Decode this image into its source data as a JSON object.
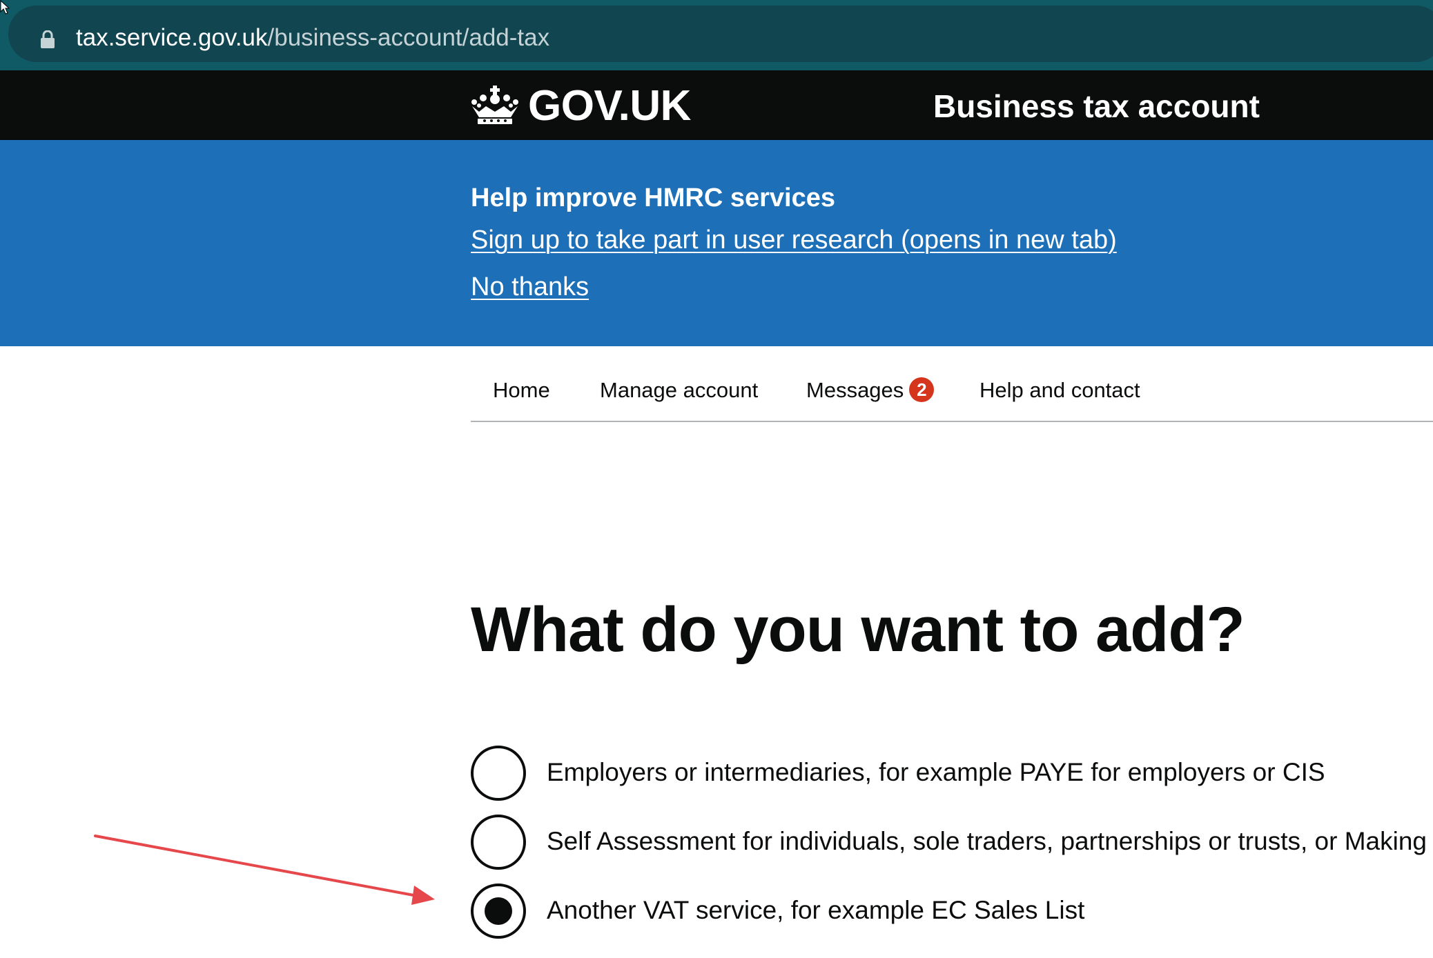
{
  "browser": {
    "url_host": "tax.service.gov.uk",
    "url_path": "/business-account/add-tax"
  },
  "header": {
    "logotype": "GOV.UK",
    "service_name": "Business tax account"
  },
  "banner": {
    "title": "Help improve HMRC services",
    "signup_link": "Sign up to take part in user research (opens in new tab)",
    "dismiss_link": "No thanks"
  },
  "nav": {
    "home": "Home",
    "manage": "Manage account",
    "messages": "Messages",
    "messages_count": "2",
    "help": "Help and contact"
  },
  "main": {
    "heading": "What do you want to add?",
    "options": [
      {
        "label": "Employers or intermediaries, for example PAYE for employers or CIS",
        "selected": false
      },
      {
        "label": "Self Assessment for individuals, sole traders, partnerships or trusts, or Making Tax Digital for Income Tax",
        "selected": false
      },
      {
        "label": "Another VAT service, for example EC Sales List",
        "selected": true
      }
    ]
  },
  "colors": {
    "header_bg": "#0b0c0c",
    "banner_bg": "#1d70b8",
    "badge_red": "#d4351c",
    "arrow_red": "#e5474b"
  },
  "icons": {
    "lock": "lock-icon",
    "crown": "crown-icon",
    "arrow": "annotation-arrow"
  }
}
